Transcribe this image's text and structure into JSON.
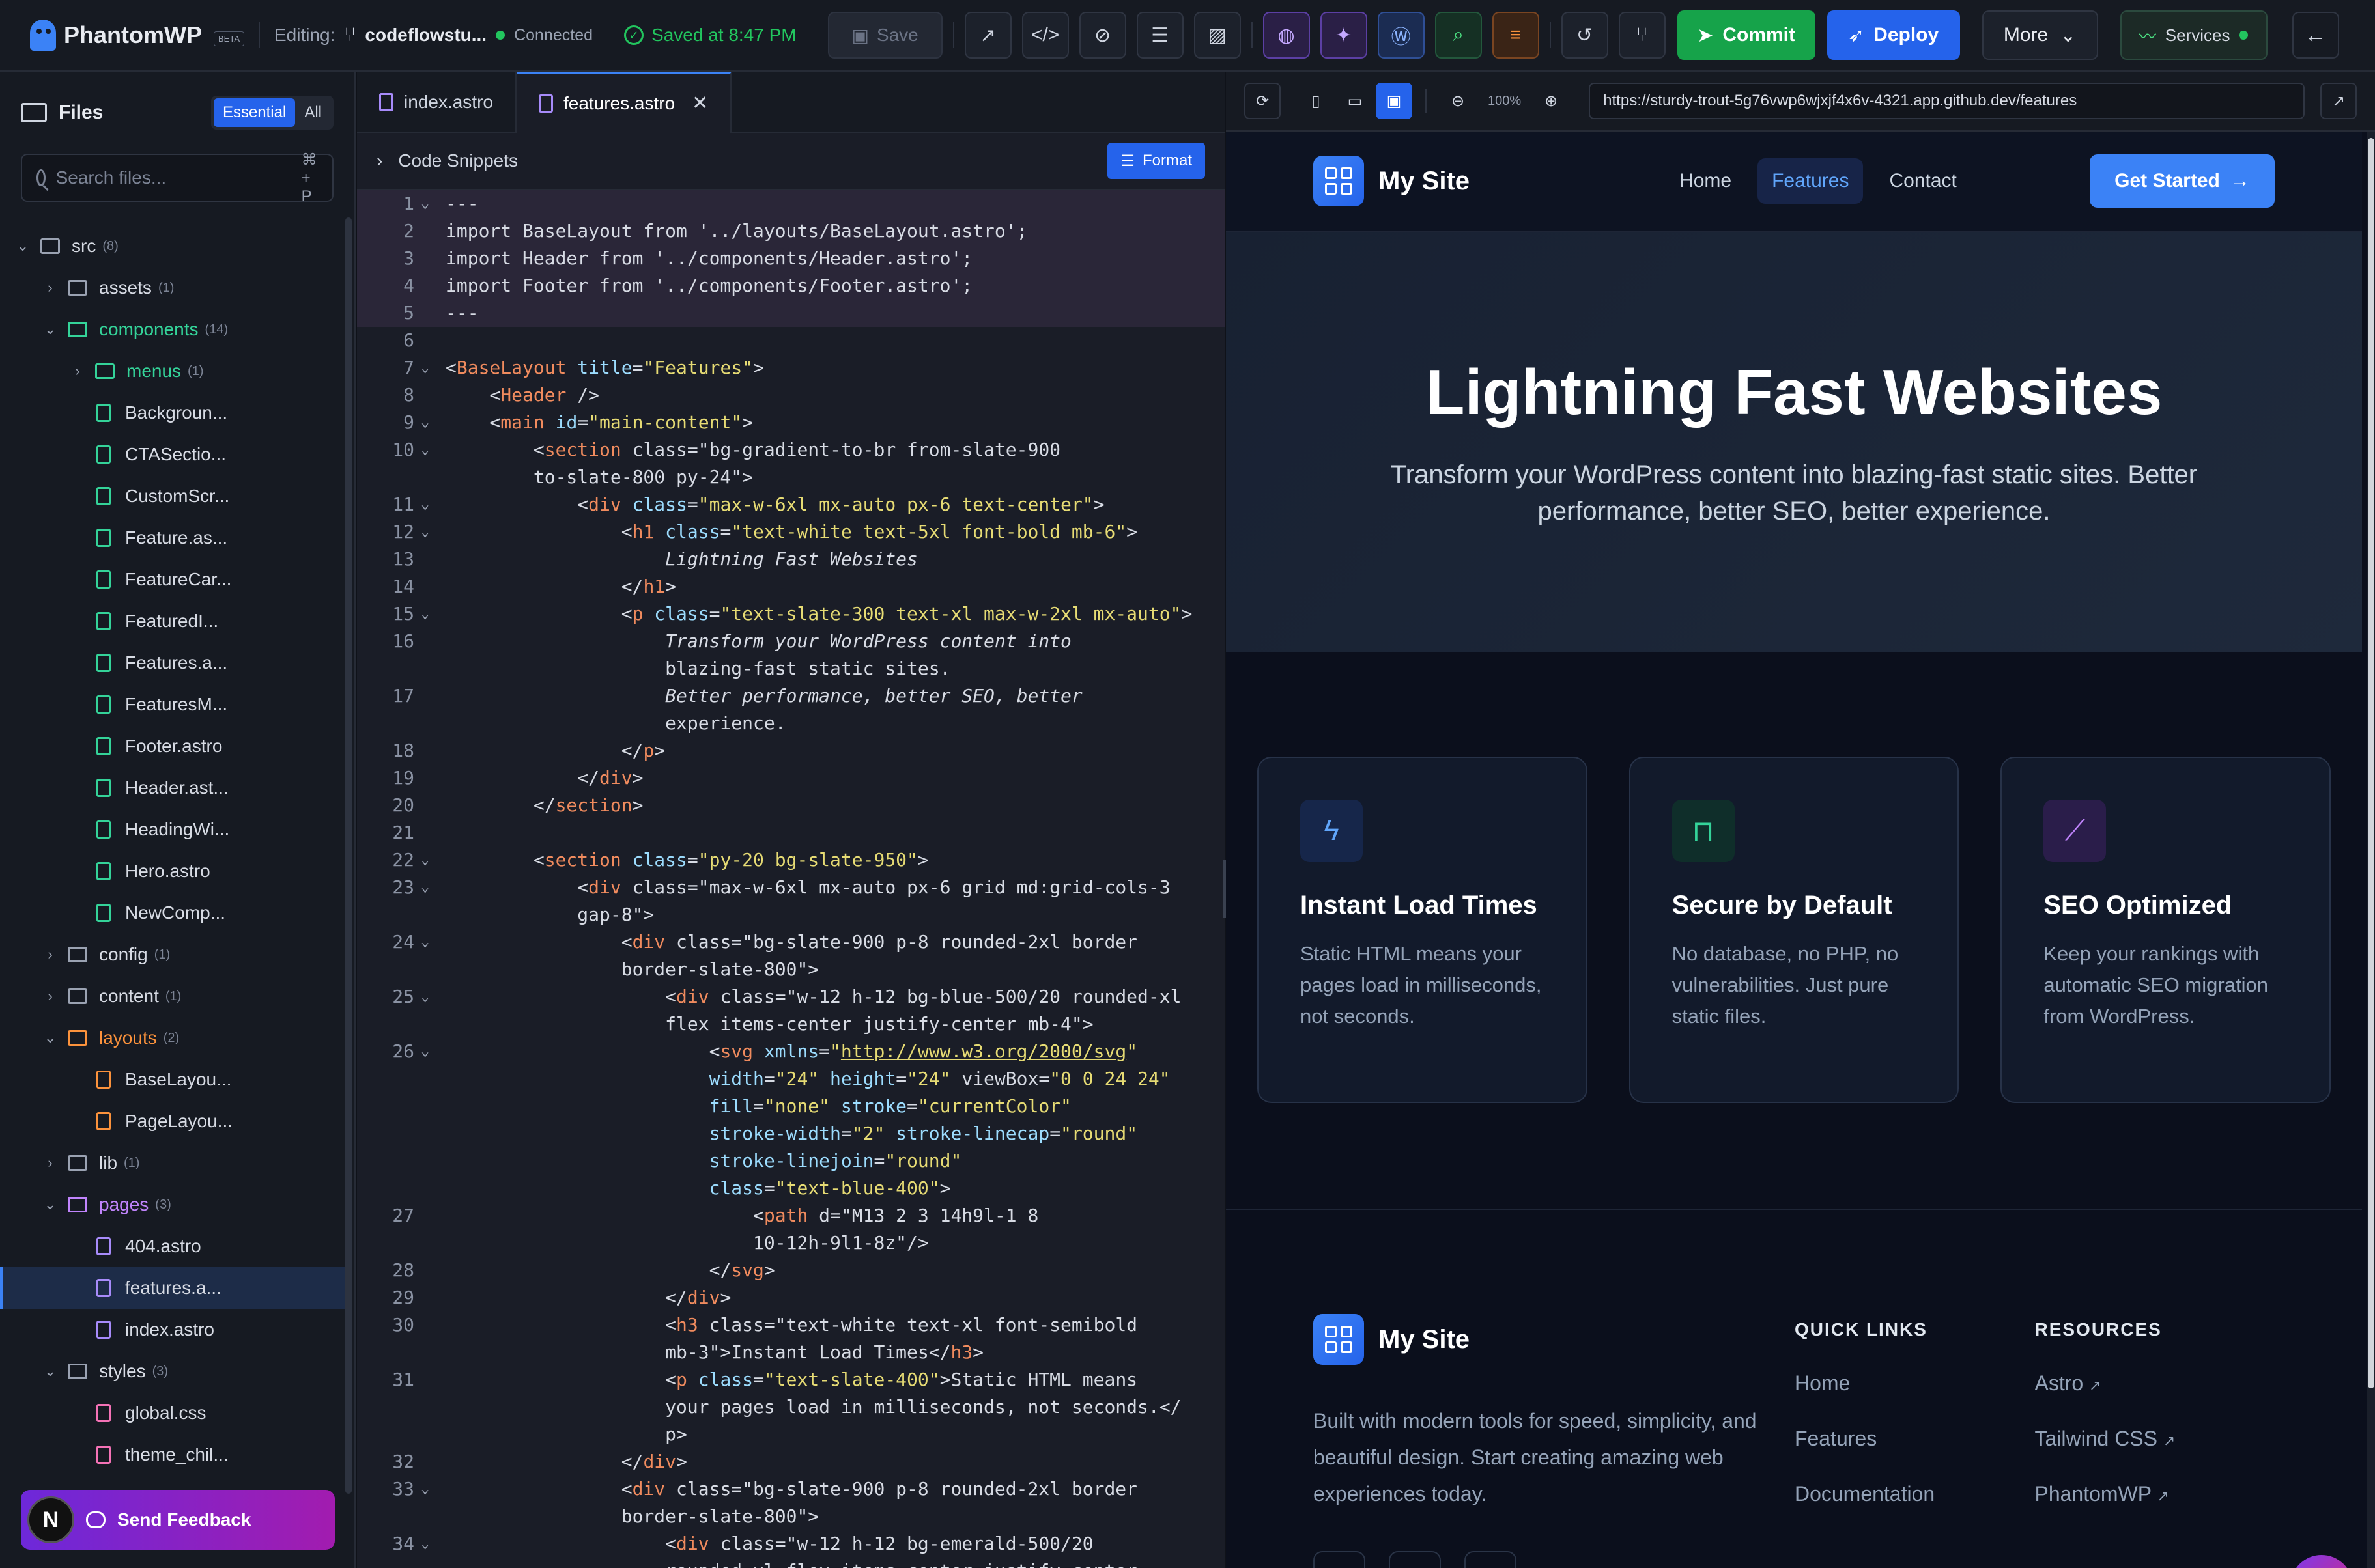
{
  "topbar": {
    "brand": "PhantomWP",
    "beta": "BETA",
    "editing_label": "Editing:",
    "repo": "codeflowstu...",
    "status": "Connected",
    "saved": "Saved at 8:47 PM",
    "save": "Save",
    "commit": "Commit",
    "deploy": "Deploy",
    "more": "More",
    "services": "Services"
  },
  "sidebar": {
    "title": "Files",
    "toggle_essential": "Essential",
    "toggle_all": "All",
    "search_placeholder": "Search files...",
    "search_shortcut": "⌘ + P",
    "tree": [
      {
        "type": "folder",
        "name": "src",
        "count": "(8)",
        "depth": 0,
        "open": true
      },
      {
        "type": "folder",
        "name": "assets",
        "count": "(1)",
        "depth": 1,
        "open": false
      },
      {
        "type": "folder",
        "name": "components",
        "count": "(14)",
        "depth": 1,
        "open": true,
        "color": "green"
      },
      {
        "type": "folder",
        "name": "menus",
        "count": "(1)",
        "depth": 2,
        "open": false,
        "color": "green"
      },
      {
        "type": "file",
        "name": "Backgroun...",
        "depth": 2,
        "color": "green"
      },
      {
        "type": "file",
        "name": "CTASectio...",
        "depth": 2,
        "color": "green"
      },
      {
        "type": "file",
        "name": "CustomScr...",
        "depth": 2,
        "color": "green"
      },
      {
        "type": "file",
        "name": "Feature.as...",
        "depth": 2,
        "color": "green"
      },
      {
        "type": "file",
        "name": "FeatureCar...",
        "depth": 2,
        "color": "green"
      },
      {
        "type": "file",
        "name": "FeaturedI...",
        "depth": 2,
        "color": "green"
      },
      {
        "type": "file",
        "name": "Features.a...",
        "depth": 2,
        "color": "green"
      },
      {
        "type": "file",
        "name": "FeaturesM...",
        "depth": 2,
        "color": "green"
      },
      {
        "type": "file",
        "name": "Footer.astro",
        "depth": 2,
        "color": "green"
      },
      {
        "type": "file",
        "name": "Header.ast...",
        "depth": 2,
        "color": "green"
      },
      {
        "type": "file",
        "name": "HeadingWi...",
        "depth": 2,
        "color": "green"
      },
      {
        "type": "file",
        "name": "Hero.astro",
        "depth": 2,
        "color": "green"
      },
      {
        "type": "file",
        "name": "NewComp...",
        "depth": 2,
        "color": "green"
      },
      {
        "type": "folder",
        "name": "config",
        "count": "(1)",
        "depth": 1,
        "open": false
      },
      {
        "type": "folder",
        "name": "content",
        "count": "(1)",
        "depth": 1,
        "open": false
      },
      {
        "type": "folder",
        "name": "layouts",
        "count": "(2)",
        "depth": 1,
        "open": true,
        "color": "orange"
      },
      {
        "type": "file",
        "name": "BaseLayou...",
        "depth": 2,
        "color": "orange"
      },
      {
        "type": "file",
        "name": "PageLayou...",
        "depth": 2,
        "color": "orange"
      },
      {
        "type": "folder",
        "name": "lib",
        "count": "(1)",
        "depth": 1,
        "open": false
      },
      {
        "type": "folder",
        "name": "pages",
        "count": "(3)",
        "depth": 1,
        "open": true,
        "color": "purple"
      },
      {
        "type": "file",
        "name": "404.astro",
        "depth": 2,
        "color": "purple"
      },
      {
        "type": "file",
        "name": "features.a...",
        "depth": 2,
        "color": "purple",
        "active": true
      },
      {
        "type": "file",
        "name": "index.astro",
        "depth": 2,
        "color": "purple"
      },
      {
        "type": "folder",
        "name": "styles",
        "count": "(3)",
        "depth": 1,
        "open": true
      },
      {
        "type": "file",
        "name": "global.css",
        "depth": 2,
        "color": "pink"
      },
      {
        "type": "file",
        "name": "theme_chil...",
        "depth": 2,
        "color": "pink"
      }
    ],
    "feedback_avatar": "N",
    "feedback": "Send Feedback"
  },
  "editor": {
    "tabs": [
      {
        "label": "index.astro",
        "active": false
      },
      {
        "label": "features.astro",
        "active": true
      }
    ],
    "snippets": "Code Snippets",
    "format": "Format",
    "lines": [
      {
        "n": "1",
        "fold": true,
        "fm": true,
        "t": "---"
      },
      {
        "n": "2",
        "fm": true,
        "t": "import BaseLayout from '../layouts/BaseLayout.astro';"
      },
      {
        "n": "3",
        "fm": true,
        "t": "import Header from '../components/Header.astro';"
      },
      {
        "n": "4",
        "fm": true,
        "t": "import Footer from '../components/Footer.astro';"
      },
      {
        "n": "5",
        "fm": true,
        "t": "---"
      },
      {
        "n": "6",
        "t": ""
      },
      {
        "n": "7",
        "fold": true,
        "t": "<BaseLayout title=\"Features\">"
      },
      {
        "n": "8",
        "t": "    <Header />"
      },
      {
        "n": "9",
        "fold": true,
        "t": "    <main id=\"main-content\">"
      },
      {
        "n": "10",
        "fold": true,
        "t": "        <section class=\"bg-gradient-to-br from-slate-900"
      },
      {
        "n": "",
        "t": "        to-slate-800 py-24\">"
      },
      {
        "n": "11",
        "fold": true,
        "t": "            <div class=\"max-w-6xl mx-auto px-6 text-center\">"
      },
      {
        "n": "12",
        "fold": true,
        "t": "                <h1 class=\"text-white text-5xl font-bold mb-6\">"
      },
      {
        "n": "13",
        "t": "                    Lightning Fast Websites"
      },
      {
        "n": "14",
        "t": "                </h1>"
      },
      {
        "n": "15",
        "fold": true,
        "t": "                <p class=\"text-slate-300 text-xl max-w-2xl mx-auto\">"
      },
      {
        "n": "16",
        "t": "                    Transform your WordPress content into"
      },
      {
        "n": "",
        "t": "                    blazing-fast static sites."
      },
      {
        "n": "17",
        "t": "                    Better performance, better SEO, better"
      },
      {
        "n": "",
        "t": "                    experience."
      },
      {
        "n": "18",
        "t": "                </p>"
      },
      {
        "n": "19",
        "t": "            </div>"
      },
      {
        "n": "20",
        "t": "        </section>"
      },
      {
        "n": "21",
        "t": ""
      },
      {
        "n": "22",
        "fold": true,
        "t": "        <section class=\"py-20 bg-slate-950\">"
      },
      {
        "n": "23",
        "fold": true,
        "t": "            <div class=\"max-w-6xl mx-auto px-6 grid md:grid-cols-3"
      },
      {
        "n": "",
        "t": "            gap-8\">"
      },
      {
        "n": "24",
        "fold": true,
        "t": "                <div class=\"bg-slate-900 p-8 rounded-2xl border"
      },
      {
        "n": "",
        "t": "                border-slate-800\">"
      },
      {
        "n": "25",
        "fold": true,
        "t": "                    <div class=\"w-12 h-12 bg-blue-500/20 rounded-xl"
      },
      {
        "n": "",
        "t": "                    flex items-center justify-center mb-4\">"
      },
      {
        "n": "26",
        "fold": true,
        "t": "                        <svg xmlns=\"http://www.w3.org/2000/svg\""
      },
      {
        "n": "",
        "t": "                        width=\"24\" height=\"24\" viewBox=\"0 0 24 24\""
      },
      {
        "n": "",
        "t": "                        fill=\"none\" stroke=\"currentColor\""
      },
      {
        "n": "",
        "t": "                        stroke-width=\"2\" stroke-linecap=\"round\""
      },
      {
        "n": "",
        "t": "                        stroke-linejoin=\"round\""
      },
      {
        "n": "",
        "t": "                        class=\"text-blue-400\">"
      },
      {
        "n": "27",
        "t": "                            <path d=\"M13 2 3 14h9l-1 8"
      },
      {
        "n": "",
        "t": "                            10-12h-9l1-8z\"/>"
      },
      {
        "n": "28",
        "t": "                        </svg>"
      },
      {
        "n": "29",
        "t": "                    </div>"
      },
      {
        "n": "30",
        "t": "                    <h3 class=\"text-white text-xl font-semibold"
      },
      {
        "n": "",
        "t": "                    mb-3\">Instant Load Times</h3>"
      },
      {
        "n": "31",
        "t": "                    <p class=\"text-slate-400\">Static HTML means"
      },
      {
        "n": "",
        "t": "                    your pages load in milliseconds, not seconds.</"
      },
      {
        "n": "",
        "t": "                    p>"
      },
      {
        "n": "32",
        "t": "                </div>"
      },
      {
        "n": "33",
        "fold": true,
        "t": "                <div class=\"bg-slate-900 p-8 rounded-2xl border"
      },
      {
        "n": "",
        "t": "                border-slate-800\">"
      },
      {
        "n": "34",
        "fold": true,
        "t": "                    <div class=\"w-12 h-12 bg-emerald-500/20"
      },
      {
        "n": "",
        "t": "                    rounded-xl flex items-center justify-center"
      }
    ]
  },
  "preview": {
    "zoom": "100%",
    "url": "https://sturdy-trout-5g76vwp6wjxjf4x6v-4321.app.github.dev/features",
    "site": {
      "name": "My Site",
      "nav": [
        {
          "label": "Home",
          "active": false
        },
        {
          "label": "Features",
          "active": true
        },
        {
          "label": "Contact",
          "active": false
        }
      ],
      "cta": "Get Started",
      "hero_title": "Lightning Fast Websites",
      "hero_text": "Transform your WordPress content into blazing-fast static sites. Better performance, better SEO, better experience.",
      "features": [
        {
          "title": "Instant Load Times",
          "text": "Static HTML means your pages load in milliseconds, not seconds.",
          "icon": "lightning-icon",
          "color": "#3b82f6"
        },
        {
          "title": "Secure by Default",
          "text": "No database, no PHP, no vulnerabilities. Just pure static files.",
          "icon": "lock-icon",
          "color": "#10b981"
        },
        {
          "title": "SEO Optimized",
          "text": "Keep your rankings with automatic SEO migration from WordPress.",
          "icon": "chart-icon",
          "color": "#a855f7"
        }
      ],
      "footer_text": "Built with modern tools for speed, simplicity, and beautiful design. Start creating amazing web experiences today.",
      "quick_links_title": "QUICK LINKS",
      "quick_links": [
        "Home",
        "Features",
        "Documentation"
      ],
      "resources_title": "RESOURCES",
      "resources": [
        "Astro",
        "Tailwind CSS",
        "PhantomWP"
      ]
    }
  }
}
